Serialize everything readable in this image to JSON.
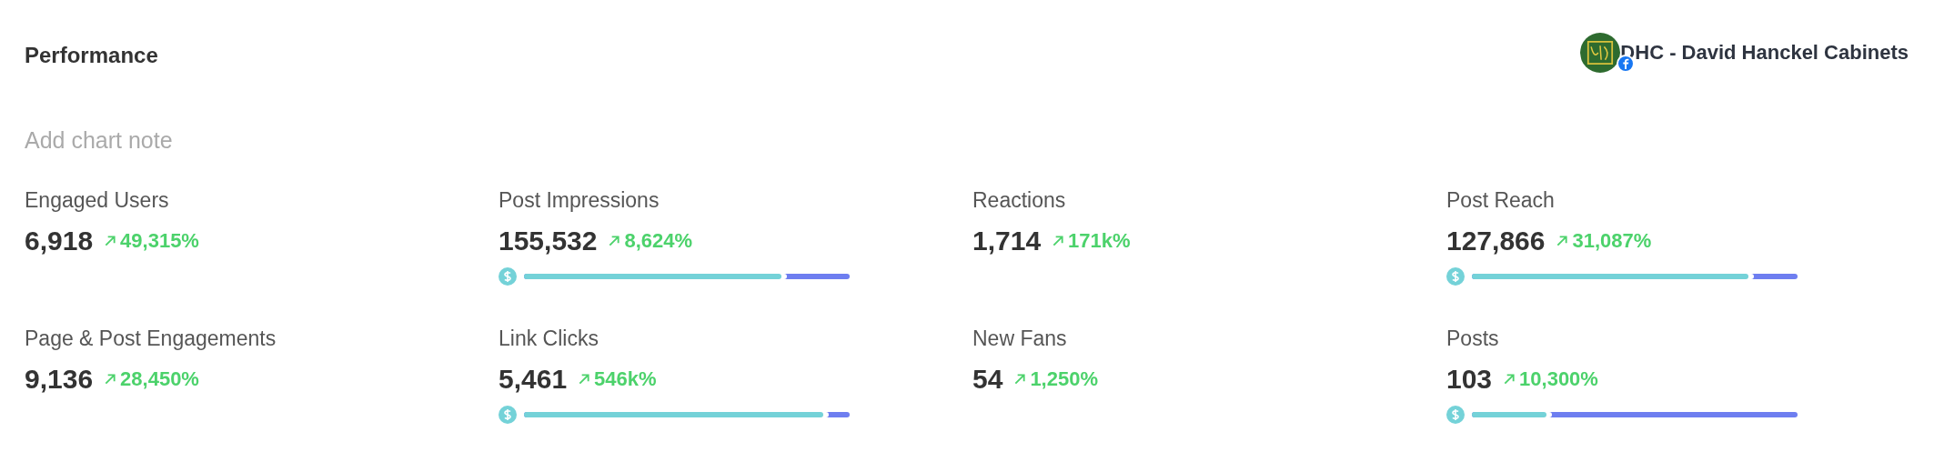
{
  "header": {
    "title": "Performance",
    "account": {
      "name": "DHC - David Hanckel Cabinets"
    }
  },
  "note": {
    "placeholder": "Add chart note"
  },
  "metrics": [
    {
      "label": "Engaged Users",
      "value": "6,918",
      "change": "49,315%"
    },
    {
      "label": "Post Impressions",
      "value": "155,532",
      "change": "8,624%",
      "level": 0.79
    },
    {
      "label": "Reactions",
      "value": "1,714",
      "change": "171k%"
    },
    {
      "label": "Post Reach",
      "value": "127,866",
      "change": "31,087%",
      "level": 0.85
    },
    {
      "label": "Page & Post Engagements",
      "value": "9,136",
      "change": "28,450%"
    },
    {
      "label": "Link Clicks",
      "value": "5,461",
      "change": "546k%",
      "level": 0.92
    },
    {
      "label": "New Fans",
      "value": "54",
      "change": "1,250%"
    },
    {
      "label": "Posts",
      "value": "103",
      "change": "10,300%",
      "level": 0.23
    }
  ]
}
